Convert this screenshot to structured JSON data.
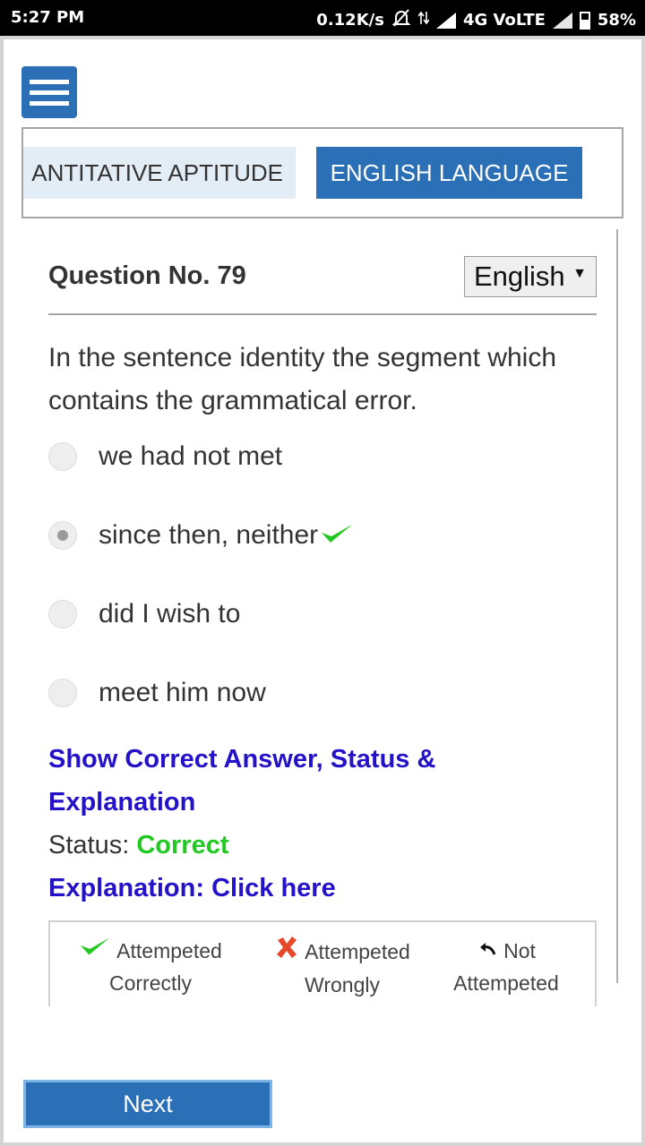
{
  "status_bar": {
    "time": "5:27 PM",
    "speed": "0.12K/s",
    "network": "4G VoLTE",
    "battery": "58%"
  },
  "tabs": [
    {
      "label": "ANTITATIVE APTITUDE",
      "active": false
    },
    {
      "label": "ENGLISH LANGUAGE",
      "active": true
    }
  ],
  "question": {
    "title": "Question No. 79",
    "language": "English",
    "text": "In the sentence identity the segment which contains the grammatical error.",
    "options": [
      {
        "label": "we had not met",
        "selected": false
      },
      {
        "label": "since then, neither",
        "selected": true
      },
      {
        "label": "did I wish to",
        "selected": false
      },
      {
        "label": "meet him now",
        "selected": false
      }
    ]
  },
  "answer": {
    "show_link": "Show Correct Answer, Status & Explanation",
    "status_label": "Status:",
    "status_value": "Correct",
    "explanation_link": "Explanation: Click here"
  },
  "legend": {
    "correct_line1": "Attempeted",
    "correct_line2": "Correctly",
    "wrong_line1": "Attempeted",
    "wrong_line2": "Wrongly",
    "not_line1": "Not",
    "not_line2": "Attempeted"
  },
  "next_label": "Next",
  "colors": {
    "accent": "#2b6fb6",
    "link": "#2412c8",
    "correct": "#22c922",
    "wrong": "#e8482a"
  }
}
